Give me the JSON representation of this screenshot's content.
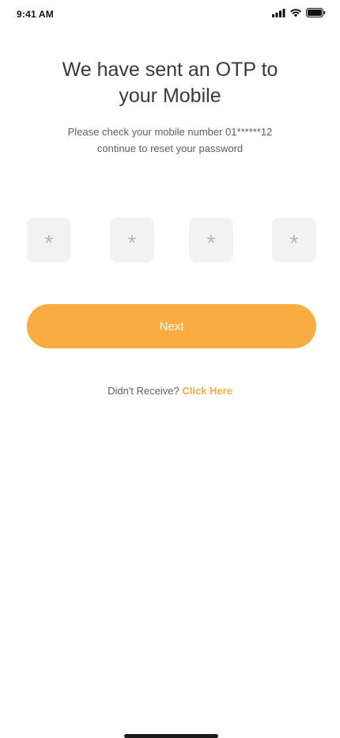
{
  "status_bar": {
    "time": "9:41 AM",
    "icons": [
      "signal-icon",
      "wifi-icon",
      "battery-icon"
    ]
  },
  "header": {
    "title_line1": "We have sent an OTP to",
    "title_line2": "your Mobile",
    "subtitle_line1": "Please check your mobile number 01******12",
    "subtitle_line2": "continue to reset your password"
  },
  "otp": {
    "digits": [
      "*",
      "*",
      "*",
      "*"
    ]
  },
  "actions": {
    "next_label": "Next",
    "resend_prompt": "Didn't Receive?",
    "resend_link": "Click Here"
  },
  "colors": {
    "accent": "#f9ad40",
    "otp_box_bg": "#f2f2f2",
    "title_text": "#3a3a3a",
    "body_text": "#5f5f5f"
  }
}
